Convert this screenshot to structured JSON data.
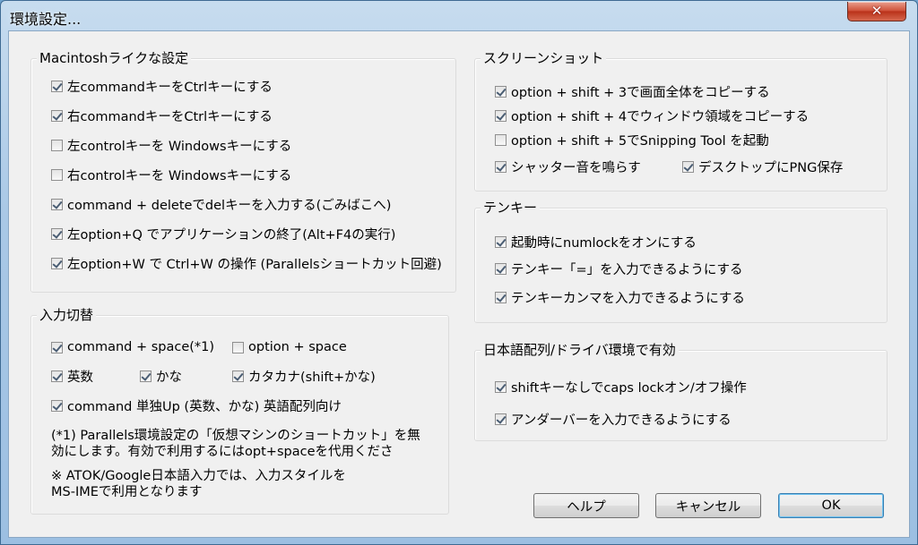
{
  "window": {
    "title": "環境設定...",
    "close_glyph": "✕"
  },
  "mac_group": {
    "title": "Macintoshライクな設定",
    "items": [
      {
        "label": "左commandキーをCtrlキーにする",
        "checked": true
      },
      {
        "label": "右commandキーをCtrlキーにする",
        "checked": true
      },
      {
        "label": "左controlキーを Windowsキーにする",
        "checked": false
      },
      {
        "label": "右controlキーを Windowsキーにする",
        "checked": false
      },
      {
        "label": "command + deleteでdelキーを入力する(ごみばこへ)",
        "checked": true
      },
      {
        "label": "左option+Q でアプリケーションの終了(Alt+F4の実行)",
        "checked": true
      },
      {
        "label": "左option+W で Ctrl+W の操作 (Parallelsショートカット回避)",
        "checked": true
      }
    ]
  },
  "input_group": {
    "title": "入力切替",
    "items": [
      {
        "label": "command + space(*1)",
        "checked": true
      },
      {
        "label": "option + space",
        "checked": false
      },
      {
        "label": "英数",
        "checked": true
      },
      {
        "label": "かな",
        "checked": true
      },
      {
        "label": "カタカナ(shift+かな)",
        "checked": true
      },
      {
        "label": "command 単独Up (英数、かな) 英語配列向け",
        "checked": true
      }
    ],
    "note1_line1": "(*1) Parallels環境設定の「仮想マシンのショートカット」を無",
    "note1_line2": "効にします。有効で利用するにはopt+spaceを代用くださ",
    "note2_line1": "※ ATOK/Google日本語入力では、入力スタイルを",
    "note2_line2": "MS-IMEで利用となります"
  },
  "screenshot_group": {
    "title": "スクリーンショット",
    "items": [
      {
        "label": "option + shift + 3で画面全体をコピーする",
        "checked": true
      },
      {
        "label": "option + shift + 4でウィンドウ領域をコピーする",
        "checked": true
      },
      {
        "label": "option + shift + 5でSnipping Tool を起動",
        "checked": false
      },
      {
        "label": "シャッター音を鳴らす",
        "checked": true
      },
      {
        "label": "デスクトップにPNG保存",
        "checked": true
      }
    ]
  },
  "tenkey_group": {
    "title": "テンキー",
    "items": [
      {
        "label": "起動時にnumlockをオンにする",
        "checked": true
      },
      {
        "label": "テンキー「=」を入力できるようにする",
        "checked": true
      },
      {
        "label": "テンキーカンマを入力できるようにする",
        "checked": true
      }
    ]
  },
  "jp_group": {
    "title": "日本語配列/ドライバ環境で有効",
    "items": [
      {
        "label": "shiftキーなしでcaps lockオン/オフ操作",
        "checked": true
      },
      {
        "label": "アンダーバーを入力できるようにする",
        "checked": true
      }
    ]
  },
  "buttons": {
    "help": "ヘルプ",
    "cancel": "キャンセル",
    "ok": "OK"
  }
}
